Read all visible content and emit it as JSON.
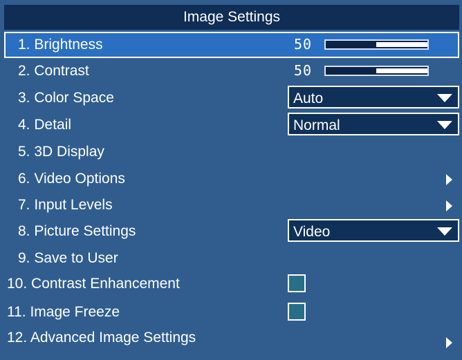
{
  "title": "Image Settings",
  "colors": {
    "panel_bg": "#305d8e",
    "title_bg": "#0f2d55",
    "selected_bg": "#2a6fc2",
    "dropdown_bg": "#0f3058",
    "checkbox_bg": "#286e87"
  },
  "menu": {
    "brightness": {
      "label": "1.  Brightness",
      "value": "50",
      "level_percent": 50
    },
    "contrast": {
      "label": "2.  Contrast",
      "value": "50",
      "level_percent": 50
    },
    "color_space": {
      "label": "3.  Color Space",
      "value": "Auto"
    },
    "detail": {
      "label": "4.  Detail",
      "value": "Normal"
    },
    "display_3d": {
      "label": "5.  3D Display"
    },
    "video_options": {
      "label": "6.  Video Options"
    },
    "input_levels": {
      "label": "7.  Input Levels"
    },
    "picture_settings": {
      "label": "8.  Picture Settings",
      "value": "Video"
    },
    "save_to_user": {
      "label": "9.  Save to User"
    },
    "contrast_enhancement": {
      "label": "10.  Contrast Enhancement",
      "checked": false
    },
    "image_freeze": {
      "label": "11.  Image Freeze",
      "checked": false
    },
    "advanced": {
      "label": "12.  Advanced Image Settings"
    }
  }
}
